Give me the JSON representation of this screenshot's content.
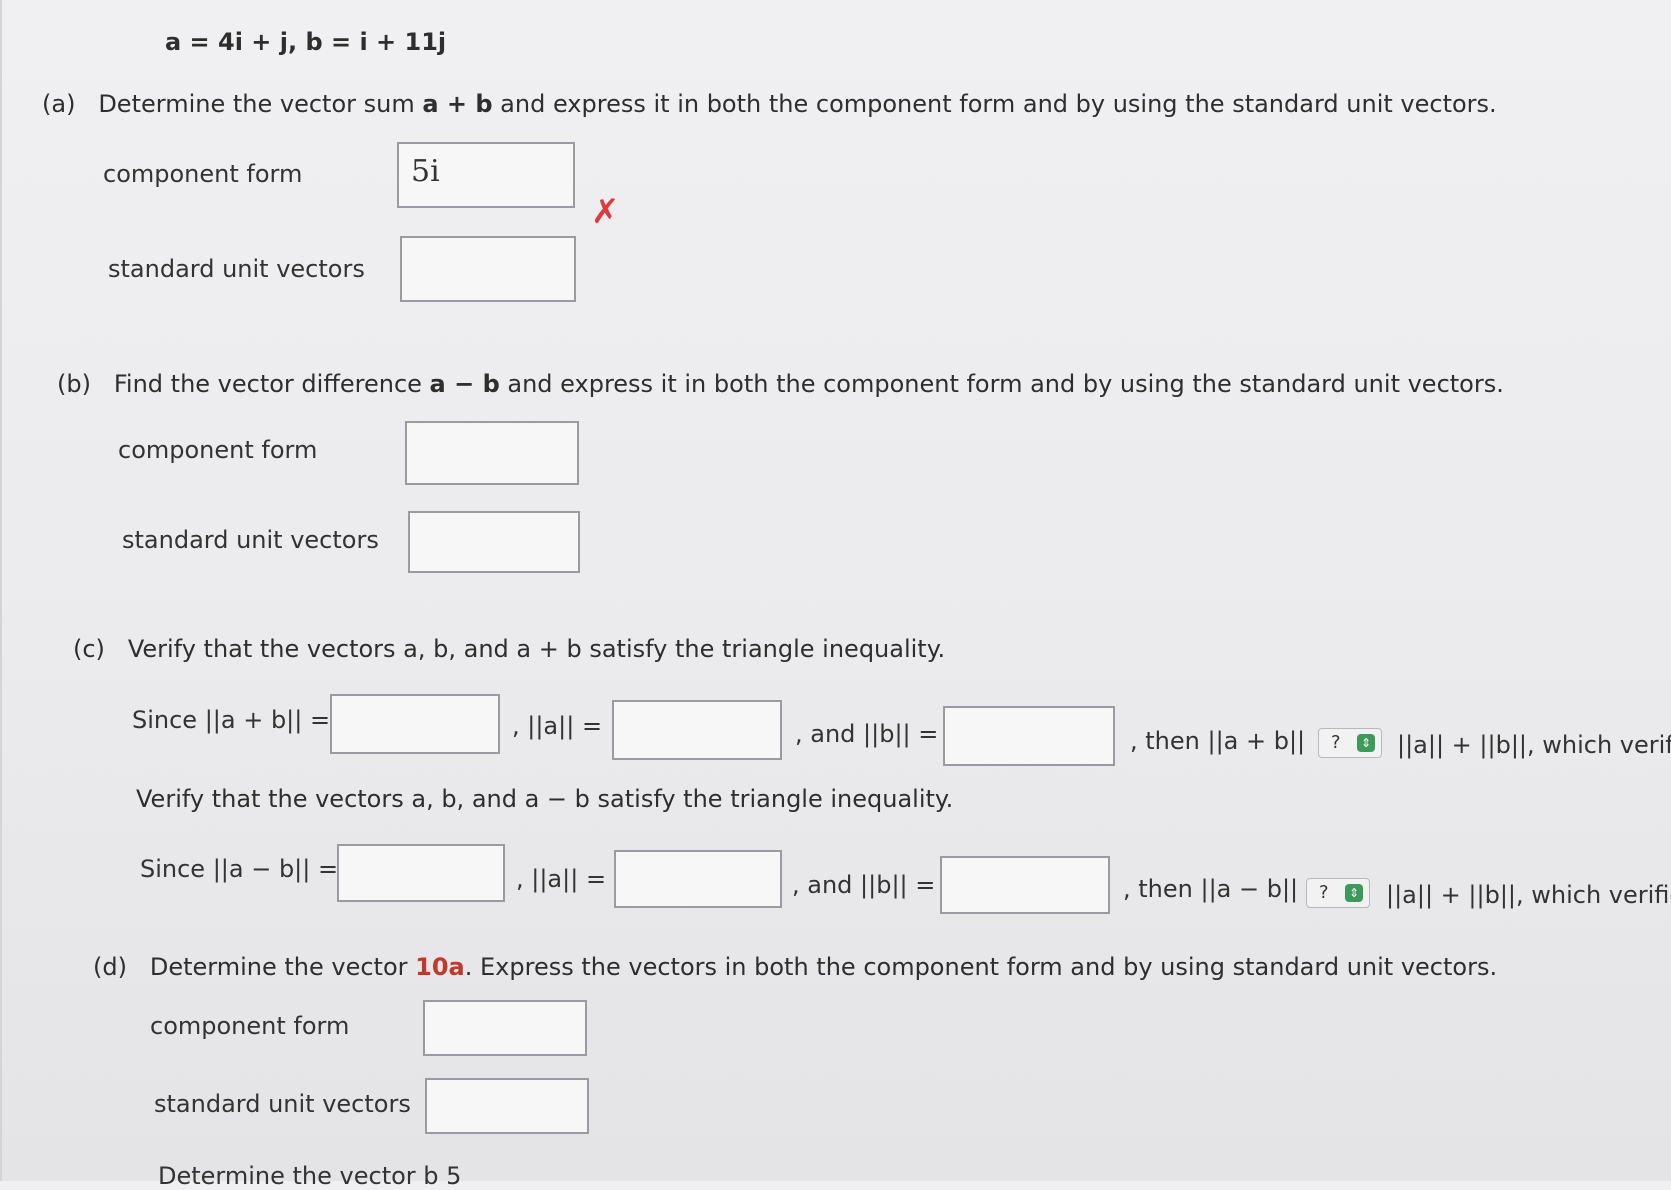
{
  "given": "a = 4i + j,  b = i + 11j",
  "part_a": {
    "marker": "(a)",
    "question_prefix": "Determine the vector sum ",
    "question_expr": "a + b",
    "question_suffix": " and express it in both the component form and by using the standard unit vectors.",
    "component_label": "component form",
    "component_value": "5i",
    "component_status_icon": "x-mark-incorrect",
    "status_mark": "✗",
    "unit_label": "standard unit vectors",
    "unit_value": ""
  },
  "part_b": {
    "marker": "(b)",
    "question_prefix": "Find the vector difference ",
    "question_expr": "a − b",
    "question_suffix": " and express it in both the component form and by using the standard unit vectors.",
    "component_label": "component form",
    "unit_label": "standard unit vectors"
  },
  "part_c": {
    "marker": "(c)",
    "question1": "Verify that the vectors a, b, and a + b satisfy the triangle inequality.",
    "row1": {
      "since": "Since ||a + b|| =",
      "norm_a": ", ||a|| =",
      "norm_b": ", and ||b|| =",
      "then": ", then ||a + b||",
      "select_value": "?",
      "tail": "||a|| + ||b||, which verif"
    },
    "question2": "Verify that the vectors a, b, and a − b satisfy the triangle inequality.",
    "row2": {
      "since": "Since ||a − b|| =",
      "norm_a": ", ||a|| =",
      "norm_b": ", and ||b|| =",
      "then": ", then ||a − b||",
      "select_value": "?",
      "tail": "||a|| + ||b||, which verifie"
    }
  },
  "part_d": {
    "marker": "(d)",
    "question_prefix": "Determine the vector ",
    "question_expr": "10a",
    "question_suffix": ". Express the vectors in both the component form and by using standard unit vectors.",
    "component_label": "component form",
    "unit_label": "standard unit vectors"
  },
  "next_partial": "Determine the vector  b  5",
  "colors": {
    "error": "#e03a3e",
    "select_arrow": "#3e9a5a",
    "accent_number": "#c0392b"
  }
}
